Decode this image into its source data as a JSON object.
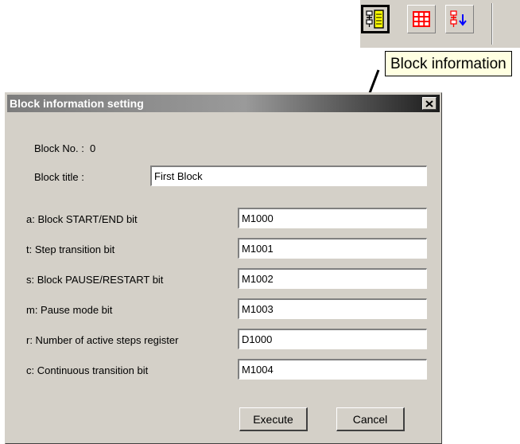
{
  "toolbar": {
    "buttons": [
      {
        "icon": "block-information-icon",
        "highlighted": true
      },
      {
        "icon": "grid-table-icon",
        "highlighted": false
      },
      {
        "icon": "sort-down-icon",
        "highlighted": false
      }
    ],
    "tooltip": "Block information"
  },
  "dialog": {
    "title": "Block information setting",
    "block_no_label": "Block No. :",
    "block_no_value": "0",
    "block_title_label": "Block title :",
    "block_title_value": "First Block",
    "fields": [
      {
        "label": "a: Block START/END bit",
        "value": "M1000"
      },
      {
        "label": "t: Step transition bit",
        "value": "M1001"
      },
      {
        "label": "s: Block PAUSE/RESTART bit",
        "value": "M1002"
      },
      {
        "label": "m: Pause mode bit",
        "value": "M1003"
      },
      {
        "label": "r: Number of active steps register",
        "value": "D1000"
      },
      {
        "label": "c: Continuous transition bit",
        "value": "M1004"
      }
    ],
    "execute_label": "Execute",
    "cancel_label": "Cancel"
  },
  "colors": {
    "face": "#d4d0c8",
    "tooltip_bg": "#ffffe1",
    "icon_yellow": "#ffff00",
    "icon_red": "#ff0000",
    "icon_blue": "#0000ff"
  }
}
